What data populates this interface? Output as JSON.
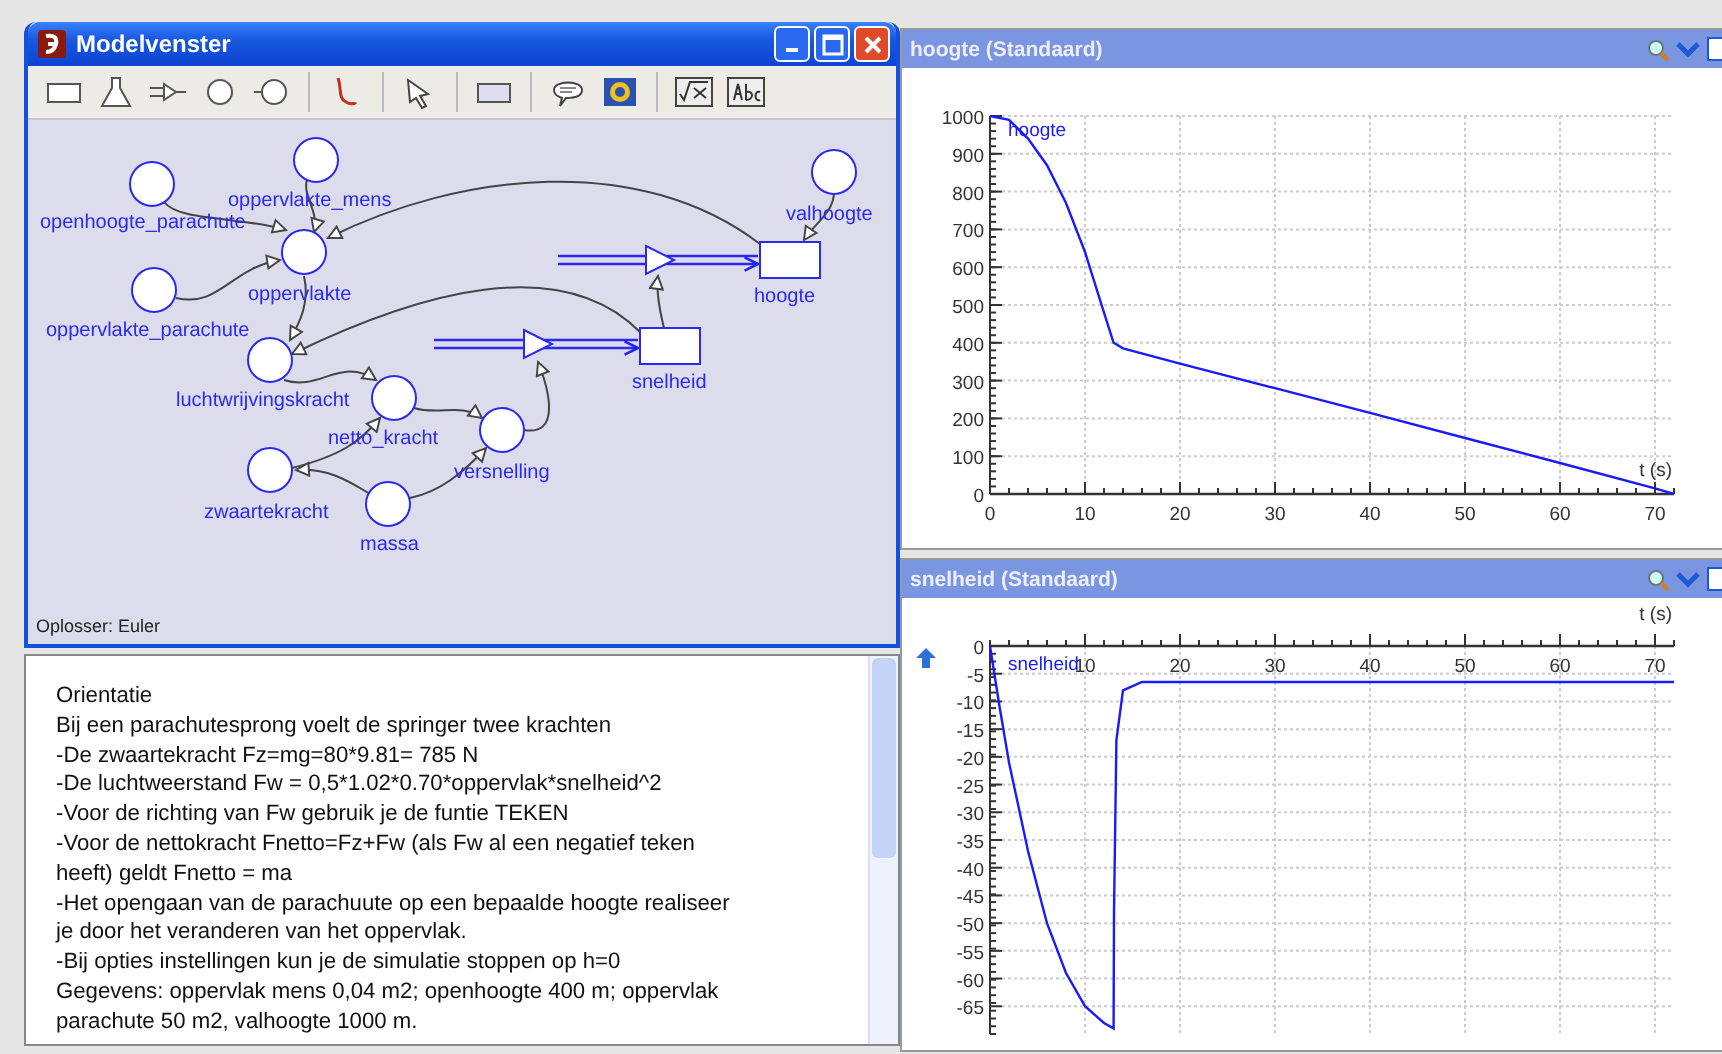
{
  "model_window": {
    "title": "Modelvenster",
    "solver": "Oplosser: Euler",
    "nodes": [
      {
        "label": "oppervlakte_mens",
        "kind": "auxiliary"
      },
      {
        "label": "openhoogte_parachute",
        "kind": "auxiliary"
      },
      {
        "label": "valhoogte",
        "kind": "auxiliary"
      },
      {
        "label": "oppervlakte",
        "kind": "auxiliary"
      },
      {
        "label": "hoogte",
        "kind": "stock"
      },
      {
        "label": "oppervlakte_parachute",
        "kind": "auxiliary"
      },
      {
        "label": "luchtwrijvingskracht",
        "kind": "auxiliary"
      },
      {
        "label": "snelheid",
        "kind": "stock"
      },
      {
        "label": "netto_kracht",
        "kind": "auxiliary"
      },
      {
        "label": "versnelling",
        "kind": "auxiliary"
      },
      {
        "label": "zwaartekracht",
        "kind": "auxiliary"
      },
      {
        "label": "massa",
        "kind": "auxiliary"
      }
    ]
  },
  "description": {
    "lines": [
      "Orientatie",
      "Bij een parachutesprong voelt de springer twee krachten",
      "-De zwaartekracht Fz=mg=80*9.81= 785 N",
      "-De luchtweerstand Fw = 0,5*1.02*0.70*oppervlak*snelheid^2",
      "-Voor de richting van Fw gebruik je de funtie TEKEN",
      "-Voor de nettokracht Fnetto=Fz+Fw (als Fw al een negatief teken",
      "heeft) geldt Fnetto = ma",
      "-Het opengaan van de parachuute op een bepaalde hoogte realiseer",
      "je door het veranderen van het oppervlak.",
      "-Bij opties instellingen kun je de simulatie stoppen op h=0",
      "Gegevens: oppervlak mens 0,04 m2; openhoogte 400 m; oppervlak",
      "parachute 50 m2, valhoogte 1000 m."
    ]
  },
  "graphs": [
    {
      "title": "hoogte (Standaard)",
      "chart_data": {
        "type": "line",
        "grid": true,
        "xlabel": "t (s)",
        "xlim": [
          0,
          72
        ],
        "ylim": [
          0,
          1000
        ],
        "xticks": [
          0,
          10,
          20,
          30,
          40,
          50,
          60,
          70
        ],
        "yticks": [
          0,
          100,
          200,
          300,
          400,
          500,
          600,
          700,
          800,
          900,
          1000
        ],
        "x": [
          0,
          2,
          4,
          6,
          8,
          10,
          12,
          13,
          14,
          20,
          30,
          40,
          50,
          60,
          70,
          72
        ],
        "series": [
          {
            "name": "hoogte",
            "color": "#1a1aff",
            "values": [
              1000,
              990,
              940,
              870,
              770,
              640,
              480,
              400,
              385,
              345,
              280,
              215,
              148,
              82,
              15,
              0
            ]
          }
        ]
      }
    },
    {
      "title": "snelheid (Standaard)",
      "chart_data": {
        "type": "line",
        "grid": true,
        "xlabel": "t (s)",
        "xlim": [
          0,
          72
        ],
        "ylim": [
          -70,
          0
        ],
        "xticks": [
          10,
          20,
          30,
          40,
          50,
          60,
          70
        ],
        "yticks": [
          0,
          -5,
          -10,
          -15,
          -20,
          -25,
          -30,
          -35,
          -40,
          -45,
          -50,
          -55,
          -60,
          -65
        ],
        "x": [
          0,
          1,
          2,
          4,
          6,
          8,
          10,
          12,
          13,
          13.05,
          13.3,
          14,
          16,
          20,
          30,
          40,
          50,
          60,
          70,
          72
        ],
        "series": [
          {
            "name": "snelheid",
            "color": "#1a1aff",
            "values": [
              0,
              -11,
              -21,
              -37,
              -50,
              -59,
              -65,
              -68,
              -69,
              -48,
              -17,
              -8,
              -6.5,
              -6.5,
              -6.5,
              -6.5,
              -6.5,
              -6.5,
              -6.5,
              -6.5
            ]
          }
        ]
      }
    }
  ]
}
